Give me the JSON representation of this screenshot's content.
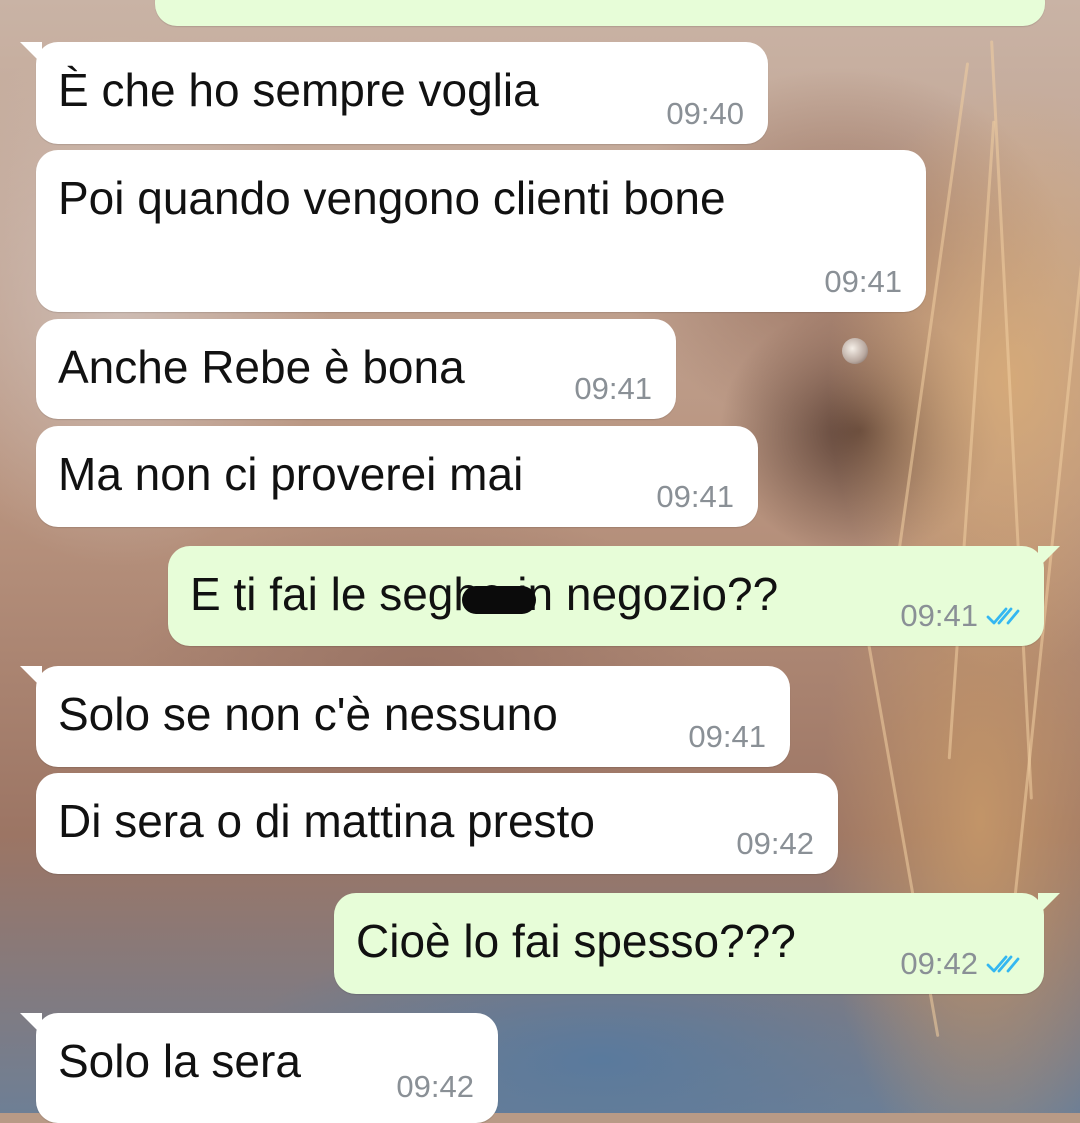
{
  "colors": {
    "incoming_bubble": "#ffffff",
    "outgoing_bubble": "#e7fdd8",
    "timestamp": "#8a9096",
    "read_ticks": "#34b7f1"
  },
  "icons": {
    "read_receipt": "double-check-icon"
  },
  "messages": [
    {
      "direction": "incoming",
      "text": "È che ho sempre voglia",
      "time": "09:40"
    },
    {
      "direction": "incoming",
      "text": "Poi quando vengono clienti bone",
      "time": "09:41"
    },
    {
      "direction": "incoming",
      "text": "Anche Rebe è bona",
      "time": "09:41"
    },
    {
      "direction": "incoming",
      "text": "Ma non ci proverei mai",
      "time": "09:41"
    },
    {
      "direction": "outgoing",
      "text": "E ti fai le seghe in negozio??",
      "time": "09:41",
      "status": "read"
    },
    {
      "direction": "incoming",
      "text": "Solo se non c'è nessuno",
      "time": "09:41"
    },
    {
      "direction": "incoming",
      "text": "Di sera o di mattina presto",
      "time": "09:42"
    },
    {
      "direction": "outgoing",
      "text": "Cioè lo fai spesso???",
      "time": "09:42",
      "status": "read"
    },
    {
      "direction": "incoming",
      "text": "Solo la sera",
      "time": "09:42"
    }
  ]
}
